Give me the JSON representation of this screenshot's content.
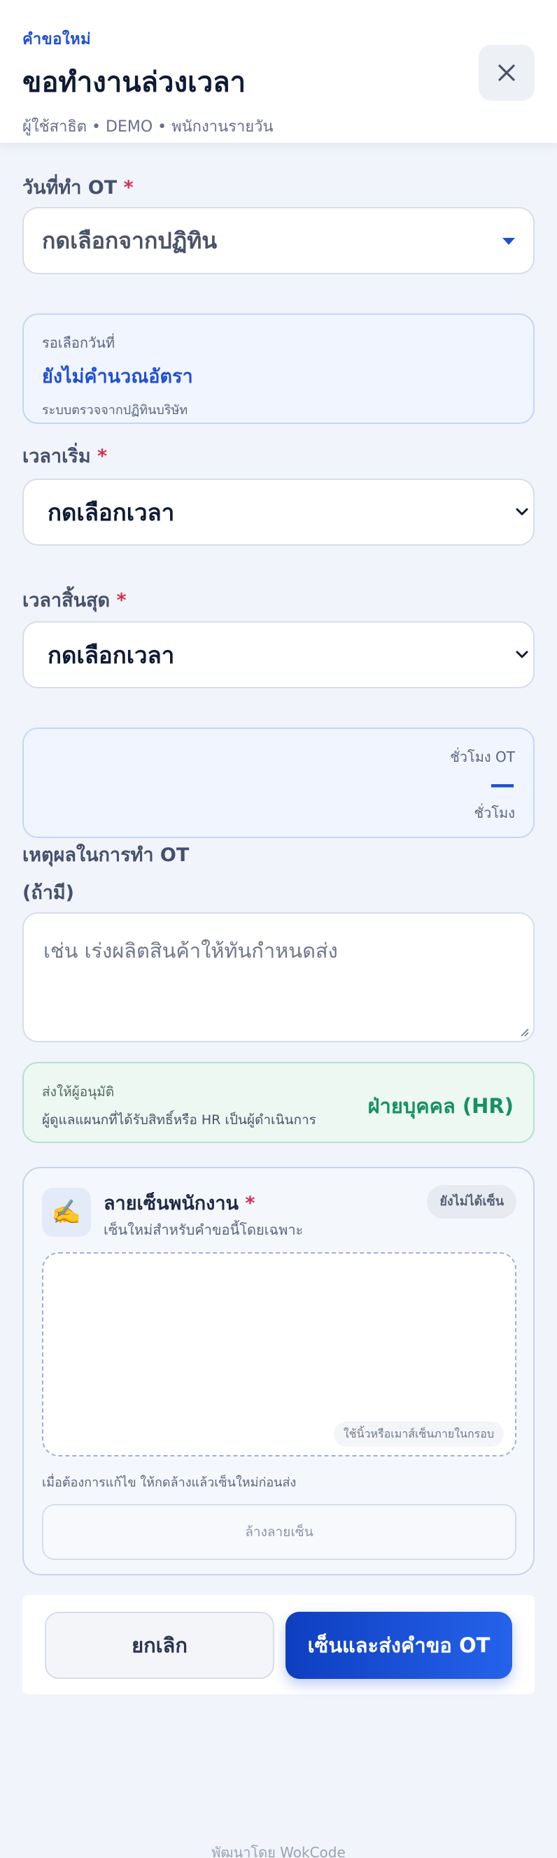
{
  "header": {
    "eyebrow": "คำขอใหม่",
    "title": "ขอทำงานล่วงเวลา",
    "subtitle": "ผู้ใช้สาธิต • DEMO • พนักงานรายวัน"
  },
  "date_field": {
    "label": "วันที่ทำ OT",
    "required_mark": "*",
    "value": "กดเลือกจากปฏิทิน"
  },
  "rate_card": {
    "status": "รอเลือกวันที่",
    "headline": "ยังไม่คำนวณอัตรา",
    "note": "ระบบตรวจจากปฏิทินบริษัท"
  },
  "start_time": {
    "label": "เวลาเริ่ม",
    "required_mark": "*",
    "value": "กดเลือกเวลา"
  },
  "end_time": {
    "label": "เวลาสิ้นสุด",
    "required_mark": "*",
    "value": "กดเลือกเวลา"
  },
  "hours_card": {
    "label": "ชั่วโมง OT",
    "value": "—",
    "unit": "ชั่วโมง"
  },
  "reason": {
    "label_line1": "เหตุผลในการทำ OT",
    "label_line2": "(ถ้ามี)",
    "placeholder": "เช่น เร่งผลิตสินค้าให้ทันกำหนดส่ง"
  },
  "approver": {
    "title": "ส่งให้ผู้อนุมัติ",
    "description": "ผู้ดูแลแผนกที่ได้รับสิทธิ์หรือ HR เป็นผู้ดำเนินการ",
    "value": "ฝ่ายบุคคล (HR)"
  },
  "signature": {
    "icon": "✍️",
    "title": "ลายเซ็นพนักงาน",
    "required_mark": "*",
    "subtitle": "เซ็นใหม่สำหรับคำขอนี้โดยเฉพาะ",
    "badge": "ยังไม่ได้เซ็น",
    "pad_hint": "ใช้นิ้วหรือเมาส์เซ็นภายในกรอบ",
    "note": "เมื่อต้องการแก้ไข ให้กดล้างแล้วเซ็นใหม่ก่อนส่ง",
    "clear_label": "ล้างลายเซ็น"
  },
  "actions": {
    "cancel_label": "ยกเลิก",
    "submit_label": "เซ็นและส่งคำขอ OT"
  },
  "credit": "พัฒนาโดย WokCode",
  "colors": {
    "accent": "#1f4fd1",
    "required": "#d6304a",
    "success": "#179062"
  }
}
